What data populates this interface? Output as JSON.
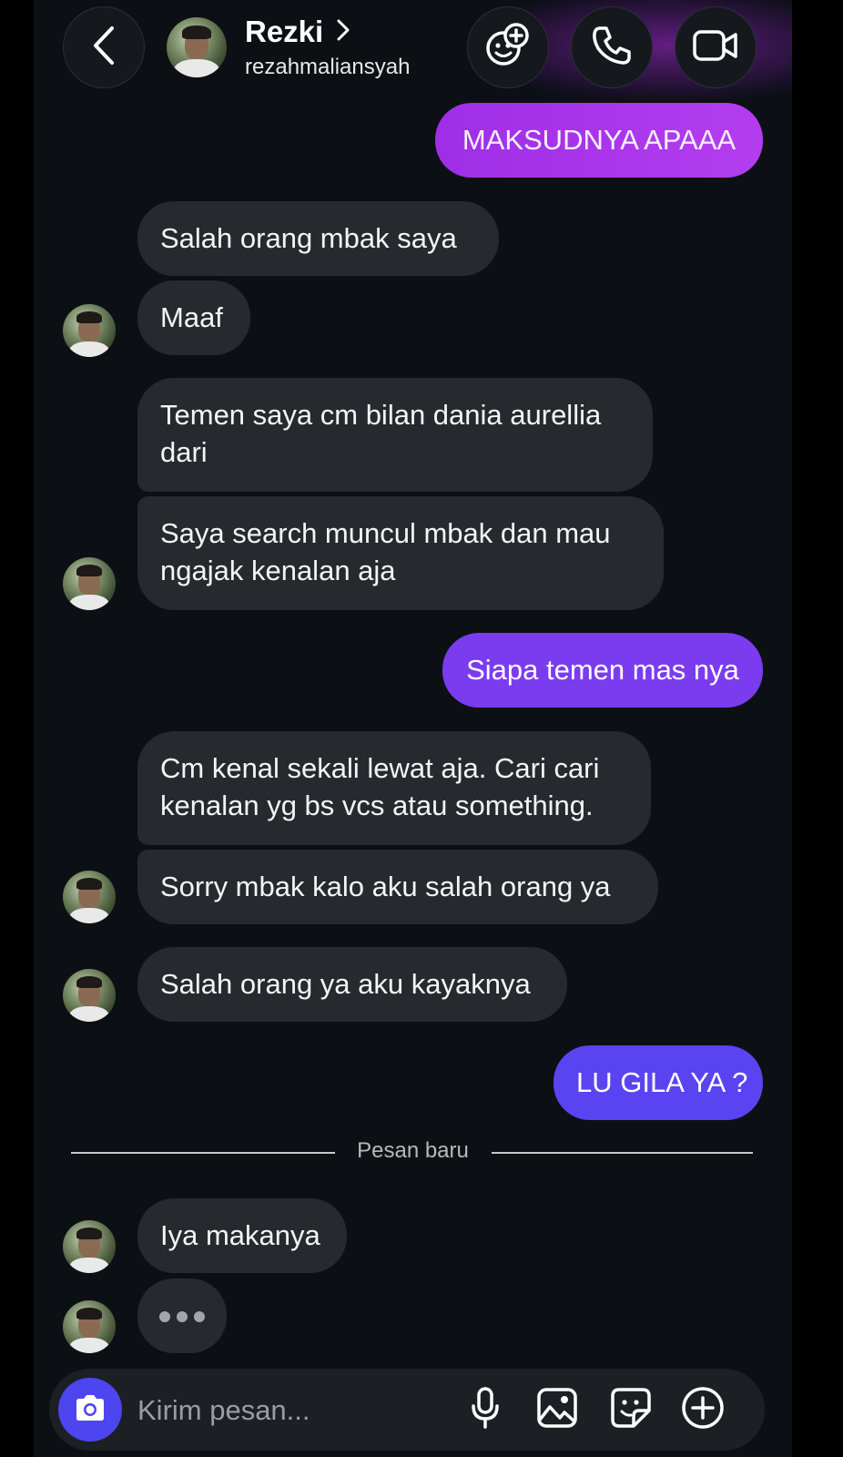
{
  "header": {
    "contact_name": "Rezki",
    "username": "rezahmaliansyah",
    "icons": [
      "back-chevron-icon",
      "chevron-right-icon",
      "effects-icon",
      "phone-icon",
      "video-camera-icon"
    ]
  },
  "messages": [
    {
      "from": "me",
      "text": "MAKSUDNYA APAAA"
    },
    {
      "from": "them",
      "text": "Salah orang mbak saya"
    },
    {
      "from": "them",
      "text": "Maaf"
    },
    {
      "from": "them",
      "text": "Temen saya cm bilan dania aurellia dari"
    },
    {
      "from": "them",
      "text": "Saya search muncul mbak dan mau ngajak kenalan aja"
    },
    {
      "from": "me",
      "text": "Siapa temen mas nya"
    },
    {
      "from": "them",
      "text": "Cm kenal sekali lewat aja. Cari cari kenalan yg bs vcs atau something."
    },
    {
      "from": "them",
      "text": "Sorry mbak kalo aku salah orang ya"
    },
    {
      "from": "them",
      "text": "Salah orang ya aku kayaknya"
    },
    {
      "from": "me",
      "text": "LU GILA YA ?"
    },
    {
      "from": "them",
      "text": "Iya makanya"
    }
  ],
  "divider": {
    "label": "Pesan baru"
  },
  "composer": {
    "placeholder": "Kirim pesan...",
    "icons": [
      "camera-icon",
      "microphone-icon",
      "gallery-icon",
      "sticker-icon",
      "plus-icon"
    ]
  },
  "colors": {
    "background": "#0c1014",
    "incoming_bubble": "#262a2f",
    "outgoing_pink": "#b43df0",
    "outgoing_purple": "#7b3cf0",
    "outgoing_violet": "#5a44f2",
    "camera_button": "#4d45f0"
  }
}
